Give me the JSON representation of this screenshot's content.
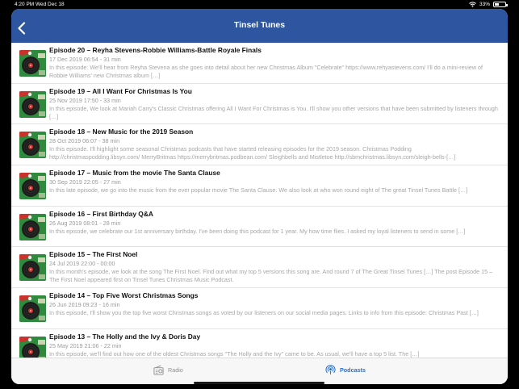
{
  "status_bar": {
    "time": "4:20 PM",
    "date": "Wed Dec 18",
    "battery": "33%",
    "battery_level": 0.33
  },
  "navbar": {
    "title": "Tinsel Tunes"
  },
  "episodes": [
    {
      "title": "Episode 20 – Reyha Stevens-Robbie Williams-Battle Royale Finals",
      "meta": "17 Dec 2019 06:54 - 31 min",
      "description": "In this episode: We'll hear from Reyha Stevena as she goes into detail about her new Christmas Album \"Celebrate\" https://www.rehyastevens.com/ I'll do a mini-review of Robbie Williams' new Christmas album […]"
    },
    {
      "title": "Episode 19 – All I Want For Christmas Is You",
      "meta": "25 Nov 2019 17:50 - 33 min",
      "description": "In this episode, We look at Mariah Carry's Classic Christmas offering All I Want For Christmas is You. I'll show you other versions that have been submitted by listeners through […]"
    },
    {
      "title": "Episode 18 – New Music for the 2019 Season",
      "meta": "28 Oct 2019 06:07 - 38 min",
      "description": "In this episode. I'll highlight some seasonal Christmas podcasts that have started releasing episodes for the 2019 season. Christmas Podding http://christmaspodding.libsyn.com/ MerryBritmas https://merrybritmas.podbean.com/ Sleighbells and Mistletoe http://sbmchristmas.libsyn.com/sleigh-bells-[…]"
    },
    {
      "title": "Episode 17 – Music from the movie The Santa Clause",
      "meta": "30 Sep 2019 22:05 - 27 min",
      "description": "In this late episode, we go into the music from the ever popular movie The Santa Clause. We also look at who won round eight of The great Tinsel Tunes Battle […]"
    },
    {
      "title": "Episode 16 – First Birthday Q&A",
      "meta": "26 Aug 2019 08:01 - 28 min",
      "description": "In this episode, we celebrate our 1st anniversary birthday. I've been doing this podcast for 1 year. My how time flies. I asked my loyal listeners to send in some […]"
    },
    {
      "title": "Episode 15 – The First Noel",
      "meta": "24 Jul 2019 22:00 - 00:00",
      "description": "In this month's episode, we look at the song The First Noel. Find out what my top 5 versions this song are. And round 7 of The Great Tinsel Tunes […] The post Episode 15 – The First Noel appeared first on Tinsel Tunes Christmas Music Podcast."
    },
    {
      "title": "Episode 14 – Top Five Worst Christmas Songs",
      "meta": "26 Jun 2019 09:23 - 16 min",
      "description": "In this episode, I'll show you the top five worst Christmas songs as voted by our listeners on our social media pages. Links to info from this episode: Christmas Past […]"
    },
    {
      "title": "Episode 13 – The Holly and the Ivy & Doris Day",
      "meta": "25 May 2019 21:06 - 22 min",
      "description": "In this episode, we'll find out how one of the oldest Christmas songs \"The Holly and the Ivy\" came to be. As usual, we'll have a top 5 list. The […]"
    }
  ],
  "tabbar": {
    "tabs": [
      {
        "label": "Radio",
        "icon": "radio-icon",
        "selected": false
      },
      {
        "label": "Podcasts",
        "icon": "podcast-icon",
        "selected": true
      }
    ]
  },
  "colors": {
    "navbar": "#2d55a0",
    "accent": "#2b6fcb",
    "thumb_green": "#2f8a3e",
    "thumb_red": "#c8332e"
  }
}
